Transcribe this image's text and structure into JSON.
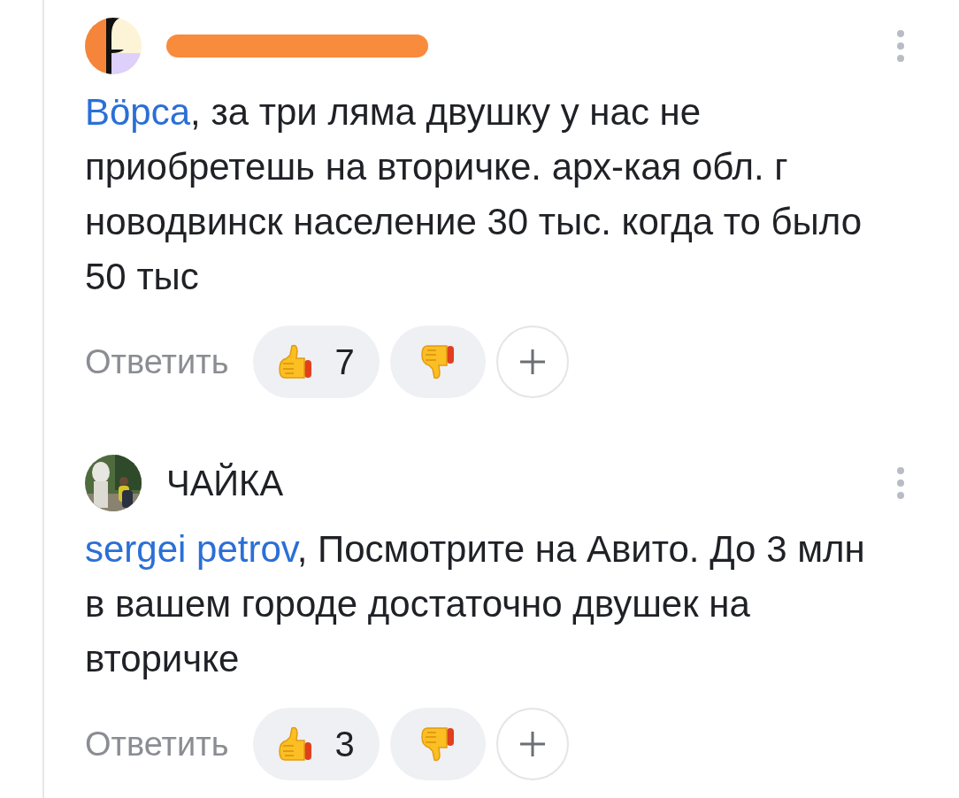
{
  "comments": [
    {
      "author": {
        "redacted": true
      },
      "avatar": {
        "kind": "pattern"
      },
      "reply_to": "Вöрса",
      "text": ", за три ляма двушку у нас не приобретешь на вторичке. арх-кая обл. г новодвинск население 30 тыс. когда то было 50 тыс",
      "reply_label": "Ответить",
      "likes": "7"
    },
    {
      "author": {
        "name": "ЧАЙКА",
        "redacted": false
      },
      "reply_to": "sergei petrov",
      "text": ", Посмотрите на Авито. До 3 млн в вашем городе достаточно двушек на вторичке",
      "reply_label": "Ответить",
      "likes": "3"
    }
  ]
}
